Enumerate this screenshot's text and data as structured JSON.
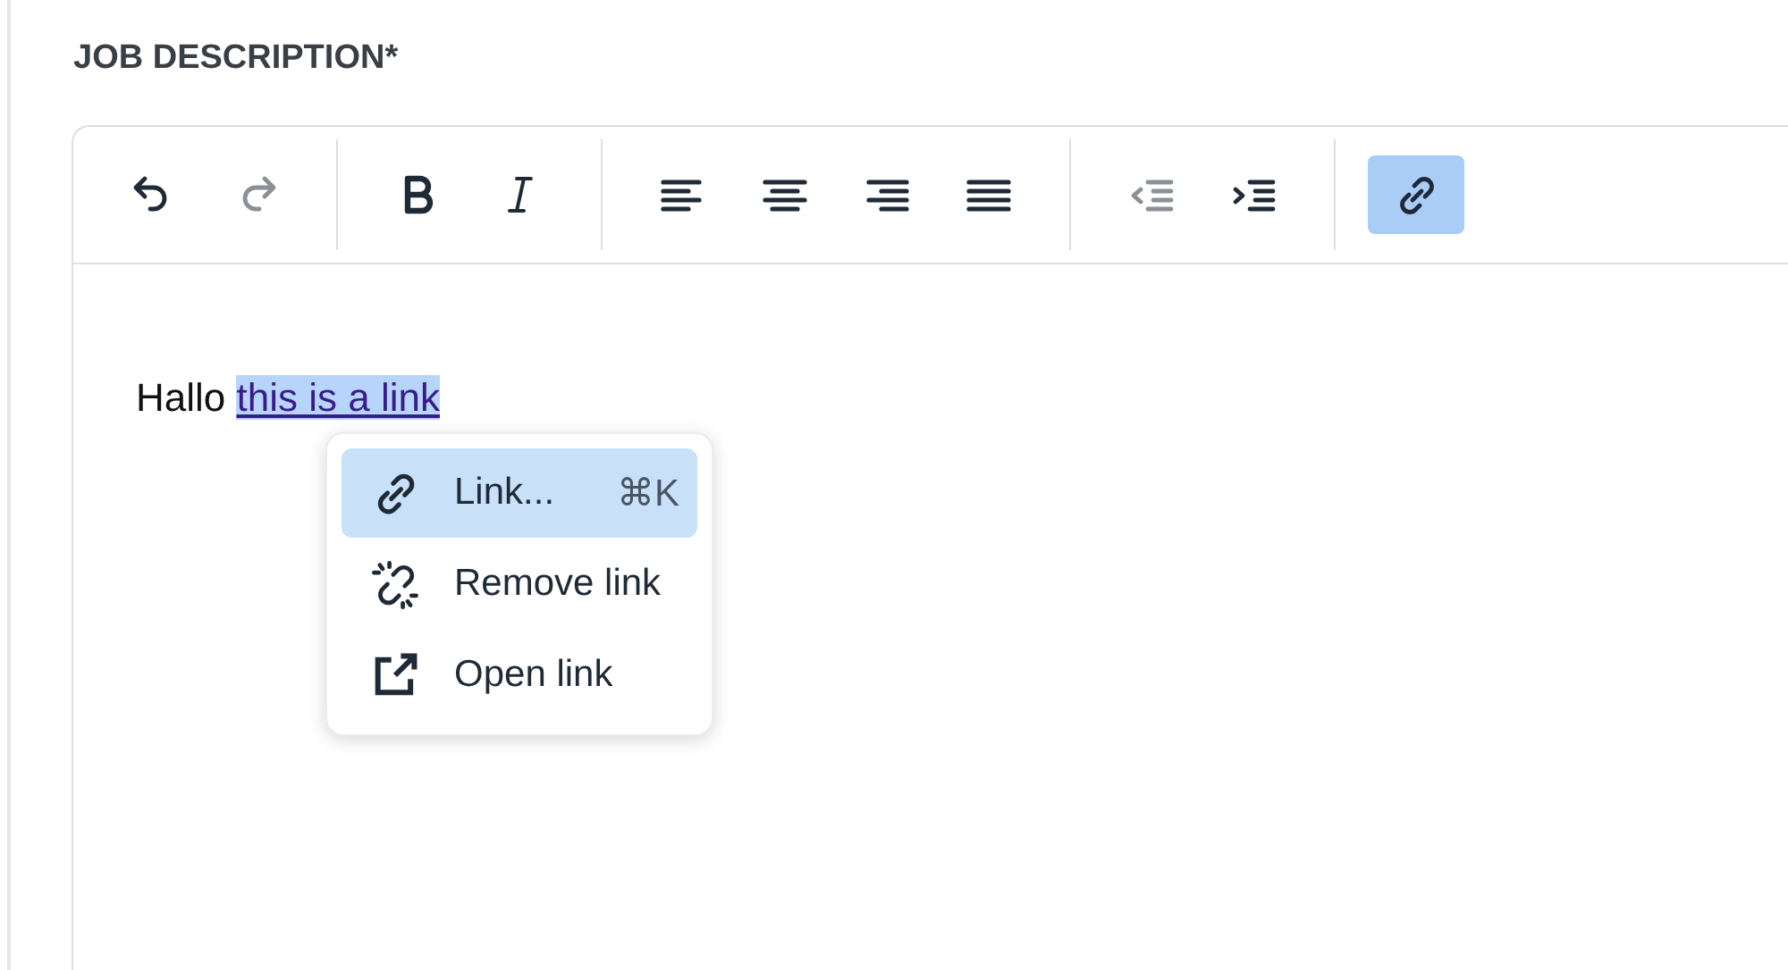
{
  "field": {
    "label": "JOB DESCRIPTION*"
  },
  "toolbar": {
    "groups": [
      [
        {
          "kind": "undo",
          "disabled": false,
          "active": false
        },
        {
          "kind": "redo",
          "disabled": true,
          "active": false
        }
      ],
      [
        {
          "kind": "bold",
          "disabled": false,
          "active": false
        },
        {
          "kind": "italic",
          "disabled": false,
          "active": false
        }
      ],
      [
        {
          "kind": "align-left",
          "disabled": false,
          "active": false
        },
        {
          "kind": "align-center",
          "disabled": false,
          "active": false
        },
        {
          "kind": "align-right",
          "disabled": false,
          "active": false
        },
        {
          "kind": "justify",
          "disabled": false,
          "active": false
        }
      ],
      [
        {
          "kind": "outdent",
          "disabled": true,
          "active": false
        },
        {
          "kind": "indent",
          "disabled": false,
          "active": false
        }
      ],
      [
        {
          "kind": "link",
          "disabled": false,
          "active": true
        }
      ]
    ]
  },
  "content": {
    "text": "Hallo",
    "link": {
      "text": "this is a link",
      "selected": true
    }
  },
  "context_menu": {
    "items": [
      {
        "kind": "link",
        "label": "Link...",
        "shortcut": "⌘K",
        "selected": true
      },
      {
        "kind": "unlink",
        "label": "Remove link",
        "selected": false
      },
      {
        "kind": "open",
        "label": "Open link",
        "selected": false
      }
    ]
  }
}
